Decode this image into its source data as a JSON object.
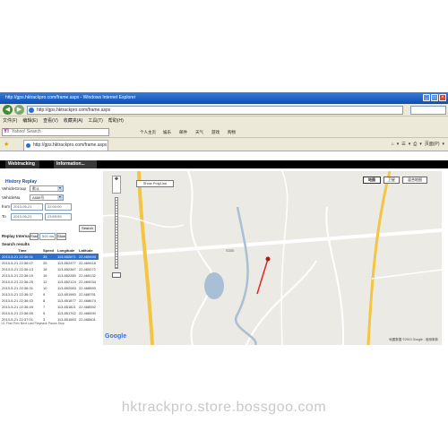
{
  "browser": {
    "title": "http://gps.hktrackpro.com/frame.aspx - Windows Internet Explorer",
    "address": "http://gps.hktrackpro.com/frame.aspx",
    "menu": [
      "文件(F)",
      "编辑(E)",
      "查看(V)",
      "收藏夹(A)",
      "工具(T)",
      "帮助(H)"
    ],
    "yahoo_label": "Yahoo! Search",
    "toolbar": [
      "个人主页",
      "娱乐",
      "邮件",
      "天气",
      "游戏",
      "购物"
    ],
    "tab_title": "http://gps.hktrackpro.com/frame.aspx",
    "tab_tools": [
      "⌂",
      "▾",
      "☰",
      "▾",
      "⎙",
      "▾",
      "页面(P)",
      "▾"
    ]
  },
  "app": {
    "tabs": [
      "Webtracking",
      "Information..."
    ],
    "panel": {
      "title": "History Replay",
      "vehicle_group_label": "VehicleGroup",
      "vehicle_group_value": "默认",
      "vehicle_no_label": "VehicleNo",
      "vehicle_no_value": "A888号",
      "from_label": "from",
      "from_date": "2013-05-21",
      "from_time": "22:00:00",
      "to_label": "To",
      "to_date": "2013-05-21",
      "to_time": "23:59:59",
      "search_button": "Search",
      "replay_label": "Replay Interval:",
      "replay_value": "500 ms",
      "replay_fast": "Fast",
      "replay_slow": "Slow",
      "results_label": "Search results",
      "columns": [
        "Time",
        "Speed",
        "Longitude",
        "Latitude"
      ],
      "rows": [
        [
          "2013-5-21 22:36:01",
          "35",
          "113.852671",
          "22.469493"
        ],
        [
          "2013-5-21 22:36:07",
          "25",
          "113.852477",
          "22.469418"
        ],
        [
          "2013-5-21 22:36:13",
          "18",
          "113.852367",
          "22.469272"
        ],
        [
          "2013-5-21 22:36:19",
          "16",
          "113.852280",
          "22.469132"
        ],
        [
          "2013-5-21 22:36:25",
          "12",
          "113.852124",
          "22.469034"
        ],
        [
          "2013-5-21 22:36:31",
          "10",
          "113.852083",
          "22.468893"
        ],
        [
          "2013-5-21 22:36:37",
          "9",
          "113.851960",
          "22.468751"
        ],
        [
          "2013-5-21 22:36:43",
          "8",
          "113.851877",
          "22.468674"
        ],
        [
          "2013-5-21 22:36:49",
          "7",
          "113.851821",
          "22.468592"
        ],
        [
          "2013-5-21 22:36:55",
          "5",
          "113.851762",
          "22.468490"
        ],
        [
          "2013-5-21 22:37:01",
          "3",
          "113.851683",
          "22.468401"
        ]
      ],
      "pager": "1/1  First  Prev  Next  Last  Playback  Pause  Stop"
    },
    "map": {
      "type_buttons": [
        "地图",
        "卫星",
        "混合地图"
      ],
      "active_type": "地图",
      "show_button": "Show PolyLine",
      "road_label": "S330",
      "logo": "Google",
      "copyright": "地图数据 ©2013 Google - 使用条款"
    }
  },
  "watermark": "hktrackpro.store.bossgoo.com",
  "colors": {
    "map_bg": "#eceae4",
    "road_major": "#f4c542",
    "water": "#a9bfd6",
    "track": "#e02828",
    "selected_row": "#2f6fd0"
  }
}
